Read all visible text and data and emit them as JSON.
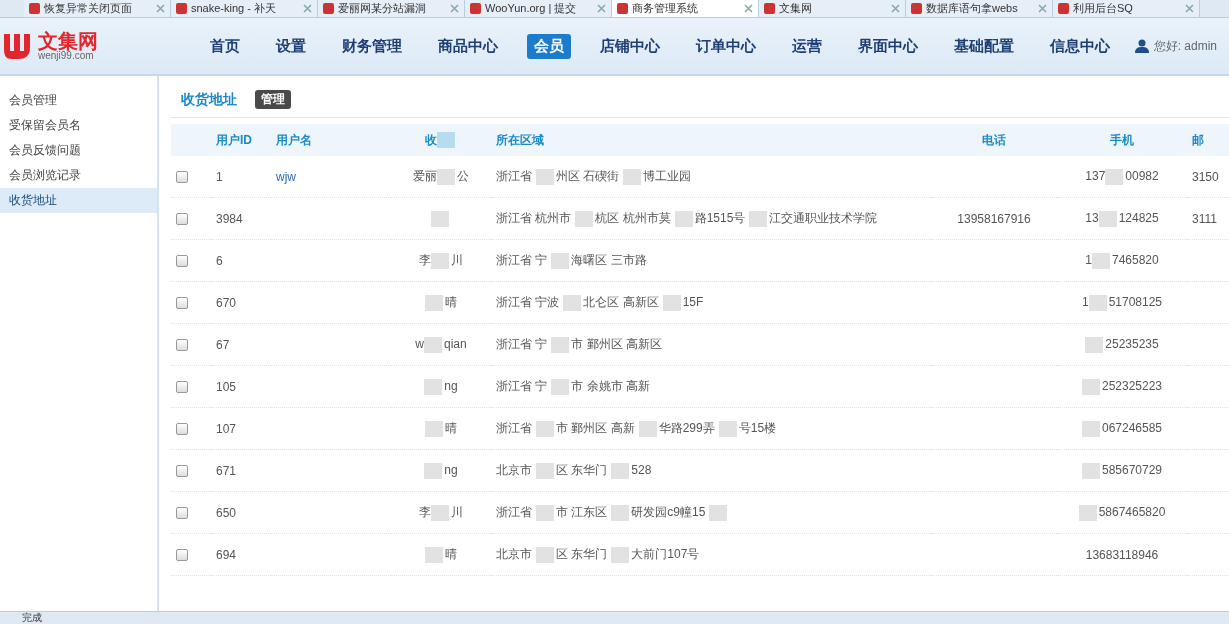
{
  "browser_tabs": [
    {
      "title": "恢复异常关闭页面",
      "selected": false
    },
    {
      "title": "snake-king - 补天",
      "selected": false
    },
    {
      "title": "爱丽网某分站漏洞",
      "selected": false
    },
    {
      "title": "WooYun.org | 提交",
      "selected": false
    },
    {
      "title": "商务管理系统",
      "selected": true
    },
    {
      "title": "文集网",
      "selected": false
    },
    {
      "title": "数据库语句拿webs",
      "selected": false
    },
    {
      "title": "利用后台SQ",
      "selected": false
    }
  ],
  "logo": {
    "name": "文集网",
    "domain": "wenji99.com"
  },
  "nav": [
    {
      "label": "首页",
      "selected": false
    },
    {
      "label": "设置",
      "selected": false
    },
    {
      "label": "财务管理",
      "selected": false
    },
    {
      "label": "商品中心",
      "selected": false
    },
    {
      "label": "会员",
      "selected": true
    },
    {
      "label": "店铺中心",
      "selected": false
    },
    {
      "label": "订单中心",
      "selected": false
    },
    {
      "label": "运营",
      "selected": false
    },
    {
      "label": "界面中心",
      "selected": false
    },
    {
      "label": "基础配置",
      "selected": false
    },
    {
      "label": "信息中心",
      "selected": false
    }
  ],
  "user": {
    "greeting": "您好: admin"
  },
  "sidebar": {
    "items": [
      {
        "label": "会员管理",
        "selected": false
      },
      {
        "label": "受保留会员名",
        "selected": false
      },
      {
        "label": "会员反馈问题",
        "selected": false
      },
      {
        "label": "会员浏览记录",
        "selected": false
      },
      {
        "label": "收货地址",
        "selected": true
      }
    ]
  },
  "section": {
    "title": "收货地址",
    "badge": "管理"
  },
  "table": {
    "columns": [
      [
        {
          "kind": "text",
          "text": "用户ID"
        }
      ],
      [
        {
          "kind": "text",
          "text": "用户名"
        }
      ],
      [
        {
          "kind": "text",
          "text": "收"
        },
        {
          "kind": "redacted"
        }
      ],
      [
        {
          "kind": "text",
          "text": "所在区域"
        }
      ],
      [
        {
          "kind": "text",
          "text": "电话"
        }
      ],
      [
        {
          "kind": "text",
          "text": "手机"
        }
      ],
      [
        {
          "kind": "text",
          "text": "邮"
        }
      ]
    ],
    "rows": [
      {
        "checked": false,
        "id": "1",
        "username": "wjw",
        "name": [
          {
            "kind": "text",
            "text": "爱丽"
          },
          {
            "kind": "redacted"
          },
          {
            "kind": "text",
            "text": "公"
          }
        ],
        "region": [
          {
            "kind": "text",
            "text": "浙江省"
          },
          {
            "kind": "redacted"
          },
          {
            "kind": "text",
            "text": "州区 石碶街"
          },
          {
            "kind": "redacted"
          },
          {
            "kind": "text",
            "text": "博工业园"
          }
        ],
        "mobile": [
          {
            "kind": "text",
            "text": "137"
          },
          {
            "kind": "redacted"
          },
          {
            "kind": "text",
            "text": "00982"
          }
        ],
        "postcode": "3150"
      },
      {
        "checked": false,
        "id": "3984",
        "name": [
          {
            "kind": "redacted"
          }
        ],
        "region": [
          {
            "kind": "text",
            "text": "浙江省 杭州市"
          },
          {
            "kind": "redacted"
          },
          {
            "kind": "text",
            "text": "杭区 杭州市莫"
          },
          {
            "kind": "redacted"
          },
          {
            "kind": "text",
            "text": "路1515号"
          },
          {
            "kind": "redacted"
          },
          {
            "kind": "text",
            "text": "江交通职业技术学院"
          }
        ],
        "phone": "13958167916",
        "mobile": [
          {
            "kind": "text",
            "text": "13"
          },
          {
            "kind": "redacted"
          },
          {
            "kind": "text",
            "text": "124825"
          }
        ],
        "postcode": "3111"
      },
      {
        "checked": false,
        "id": "6",
        "name": [
          {
            "kind": "text",
            "text": "李"
          },
          {
            "kind": "redacted"
          },
          {
            "kind": "text",
            "text": "川"
          }
        ],
        "region": [
          {
            "kind": "text",
            "text": "浙江省 宁"
          },
          {
            "kind": "redacted"
          },
          {
            "kind": "text",
            "text": "海曙区 三市路"
          }
        ],
        "mobile": [
          {
            "kind": "text",
            "text": "1"
          },
          {
            "kind": "redacted"
          },
          {
            "kind": "text",
            "text": "7465820"
          }
        ]
      },
      {
        "checked": false,
        "id": "670",
        "name": [
          {
            "kind": "redacted"
          },
          {
            "kind": "text",
            "text": "晴"
          }
        ],
        "region": [
          {
            "kind": "text",
            "text": "浙江省 宁波"
          },
          {
            "kind": "redacted"
          },
          {
            "kind": "text",
            "text": "北仑区 高新区"
          },
          {
            "kind": "redacted"
          },
          {
            "kind": "text",
            "text": "15F"
          }
        ],
        "mobile": [
          {
            "kind": "text",
            "text": "1"
          },
          {
            "kind": "redacted"
          },
          {
            "kind": "text",
            "text": "51708125"
          }
        ]
      },
      {
        "checked": false,
        "id": "67",
        "name": [
          {
            "kind": "text",
            "text": "w"
          },
          {
            "kind": "redacted"
          },
          {
            "kind": "text",
            "text": "qian"
          }
        ],
        "region": [
          {
            "kind": "text",
            "text": "浙江省 宁"
          },
          {
            "kind": "redacted"
          },
          {
            "kind": "text",
            "text": "市 鄞州区 高新区"
          }
        ],
        "mobile": [
          {
            "kind": "redacted"
          },
          {
            "kind": "text",
            "text": "25235235"
          }
        ]
      },
      {
        "checked": false,
        "id": "105",
        "name": [
          {
            "kind": "redacted"
          },
          {
            "kind": "text",
            "text": "ng"
          }
        ],
        "region": [
          {
            "kind": "text",
            "text": "浙江省 宁"
          },
          {
            "kind": "redacted"
          },
          {
            "kind": "text",
            "text": "市 余姚市 高新"
          }
        ],
        "mobile": [
          {
            "kind": "redacted"
          },
          {
            "kind": "text",
            "text": "252325223"
          }
        ]
      },
      {
        "checked": false,
        "id": "107",
        "name": [
          {
            "kind": "redacted"
          },
          {
            "kind": "text",
            "text": "晴"
          }
        ],
        "region": [
          {
            "kind": "text",
            "text": "浙江省"
          },
          {
            "kind": "redacted"
          },
          {
            "kind": "text",
            "text": "市 鄞州区 高新"
          },
          {
            "kind": "redacted"
          },
          {
            "kind": "text",
            "text": "华路299弄"
          },
          {
            "kind": "redacted"
          },
          {
            "kind": "text",
            "text": "号15楼"
          }
        ],
        "mobile": [
          {
            "kind": "redacted"
          },
          {
            "kind": "text",
            "text": "067246585"
          }
        ]
      },
      {
        "checked": false,
        "id": "671",
        "name": [
          {
            "kind": "redacted"
          },
          {
            "kind": "text",
            "text": "ng"
          }
        ],
        "region": [
          {
            "kind": "text",
            "text": "北京市"
          },
          {
            "kind": "redacted"
          },
          {
            "kind": "text",
            "text": "区 东华门"
          },
          {
            "kind": "redacted"
          },
          {
            "kind": "text",
            "text": "528"
          }
        ],
        "mobile": [
          {
            "kind": "redacted"
          },
          {
            "kind": "text",
            "text": "585670729"
          }
        ]
      },
      {
        "checked": false,
        "id": "650",
        "name": [
          {
            "kind": "text",
            "text": "李"
          },
          {
            "kind": "redacted"
          },
          {
            "kind": "text",
            "text": "川"
          }
        ],
        "region": [
          {
            "kind": "text",
            "text": "浙江省"
          },
          {
            "kind": "redacted"
          },
          {
            "kind": "text",
            "text": "市 江东区"
          },
          {
            "kind": "redacted"
          },
          {
            "kind": "text",
            "text": "研发园c9幢15"
          },
          {
            "kind": "redacted"
          }
        ],
        "mobile": [
          {
            "kind": "redacted"
          },
          {
            "kind": "text",
            "text": "5867465820"
          }
        ]
      },
      {
        "checked": false,
        "id": "694",
        "name": [
          {
            "kind": "redacted"
          },
          {
            "kind": "text",
            "text": "晴"
          }
        ],
        "region": [
          {
            "kind": "text",
            "text": "北京市"
          },
          {
            "kind": "redacted"
          },
          {
            "kind": "text",
            "text": "区 东华门"
          },
          {
            "kind": "redacted"
          },
          {
            "kind": "text",
            "text": "大前门107号"
          }
        ],
        "mobile": [
          {
            "kind": "text",
            "text": "13683118946"
          }
        ]
      }
    ]
  },
  "status_bar": {
    "text": "完成"
  }
}
